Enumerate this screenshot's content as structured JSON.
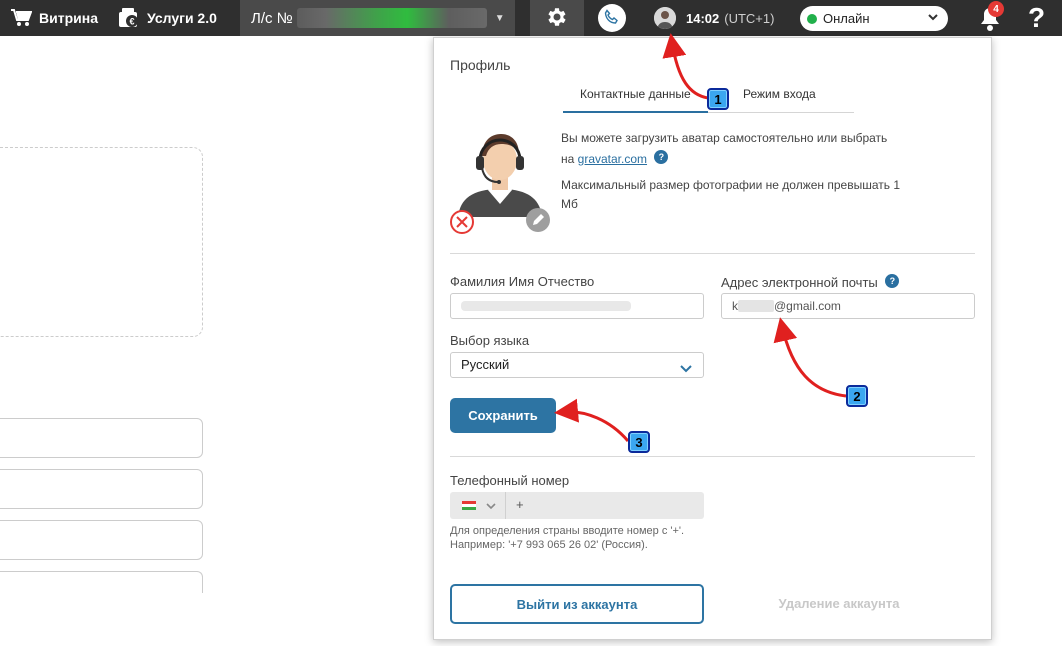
{
  "topbar": {
    "vitrina_label": "Витрина",
    "uslugi_label": "Услуги 2.0",
    "account_label": "Л/с №",
    "time": "14:02",
    "timezone": "(UTC+1)",
    "status": "Онлайн",
    "notifications_count": "4",
    "help_label": "?"
  },
  "profile": {
    "title": "Профиль",
    "tabs": [
      {
        "label": "Контактные данные",
        "active": true
      },
      {
        "label": "Режим входа",
        "active": false
      }
    ],
    "avatar_text_line1": "Вы можете загрузить аватар самостоятельно или выбрать",
    "avatar_text_line2_prefix": "на",
    "gravatar_link": "gravatar.com",
    "max_size_text": "Максимальный размер фотографии не должен превышать 1 Мб",
    "help_icon_label": "?",
    "full_name_label": "Фамилия Имя Отчество",
    "email_label": "Адрес электронной почты",
    "email_prefix": "k",
    "email_suffix": "@gmail.com",
    "language_label": "Выбор языка",
    "language_value": "Русский",
    "save_label": "Сохранить",
    "phone_label": "Телефонный номер",
    "phone_placeholder": "+",
    "phone_hint": "Для определения страны вводите номер с '+'. Например: '+7 993 065 26 02' (Россия).",
    "logout_label": "Выйти из аккаунта",
    "delete_label": "Удаление аккаунта"
  },
  "annotations": [
    {
      "num": "1"
    },
    {
      "num": "2"
    },
    {
      "num": "3"
    }
  ],
  "colors": {
    "topbar_bg": "#2f2f2f",
    "accent": "#2d74a3",
    "online": "#21b04b",
    "badge": "#e53935",
    "annotation_arrow": "#e0201f"
  }
}
